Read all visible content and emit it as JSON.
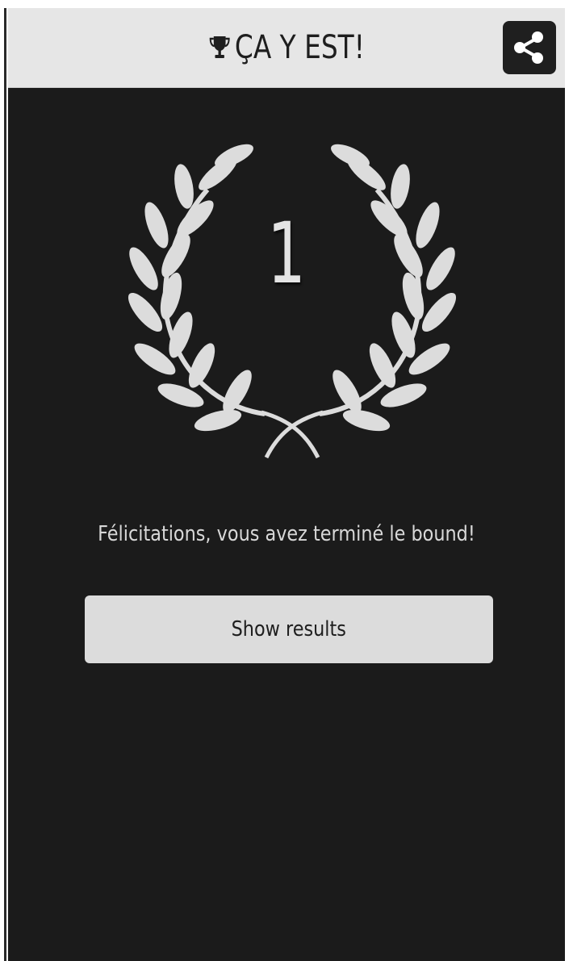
{
  "header": {
    "title": "ÇA Y EST!",
    "trophy_icon": "trophy-icon",
    "share_icon": "share-icon"
  },
  "result": {
    "rank": "1",
    "laurel_icon": "laurel-wreath-icon",
    "message": "Félicitations, vous avez terminé le bound!"
  },
  "actions": {
    "show_results_label": "Show results"
  },
  "colors": {
    "header_bg": "#e6e6e6",
    "content_bg": "#1b1b1b",
    "laurel": "#dcdcdc",
    "button_bg": "#dcdcdc"
  }
}
